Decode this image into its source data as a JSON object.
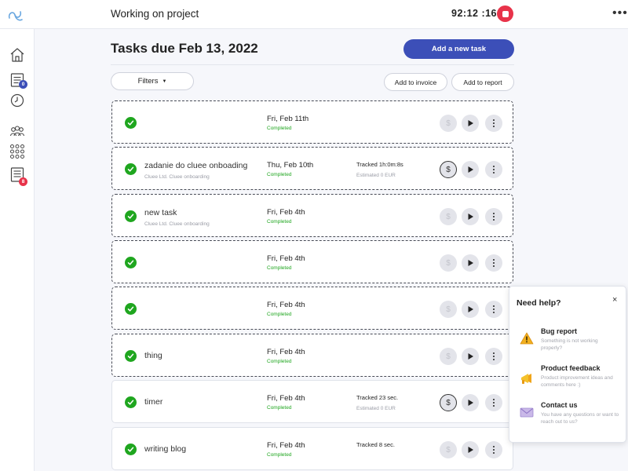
{
  "topbar": {
    "title": "Working on project",
    "timer": "92:12 :16",
    "more": "•••"
  },
  "sidebar": {
    "items": [
      {
        "name": "home",
        "icon": "home-icon"
      },
      {
        "name": "tasks",
        "icon": "tasks-list-icon",
        "badge": "0"
      },
      {
        "name": "time",
        "icon": "clock-icon"
      },
      {
        "name": "team",
        "icon": "people-icon"
      },
      {
        "name": "apps",
        "icon": "grid-icon"
      },
      {
        "name": "reports",
        "icon": "report-icon",
        "badge": "8"
      }
    ]
  },
  "main": {
    "title": "Tasks due Feb 13, 2022",
    "add_task_label": "Add a new task",
    "filters_label": "Filters",
    "add_invoice_label": "Add to invoice",
    "add_report_label": "Add to report"
  },
  "tasks": [
    {
      "name": "",
      "sub": "",
      "date": "Fri, Feb 11th",
      "status": "Completed",
      "tracked": "",
      "estimated": ""
    },
    {
      "name": "zadanie do cluee onboading",
      "sub": "Cluee Ltd. Cluee onboarding",
      "date": "Thu, Feb 10th",
      "status": "Completed",
      "tracked": "Tracked 1h:0m:8s",
      "estimated": "Estimated 0 EUR"
    },
    {
      "name": "new task",
      "sub": "Cluee Ltd. Cluee onboarding",
      "date": "Fri, Feb 4th",
      "status": "Completed",
      "tracked": "",
      "estimated": ""
    },
    {
      "name": "",
      "sub": "",
      "date": "Fri, Feb 4th",
      "status": "Completed",
      "tracked": "",
      "estimated": ""
    },
    {
      "name": "",
      "sub": "",
      "date": "Fri, Feb 4th",
      "status": "Completed",
      "tracked": "",
      "estimated": ""
    },
    {
      "name": "thing",
      "sub": "",
      "date": "Fri, Feb 4th",
      "status": "Completed",
      "tracked": "",
      "estimated": ""
    },
    {
      "name": "timer",
      "sub": "",
      "date": "Fri, Feb 4th",
      "status": "Completed",
      "tracked": "Tracked 23 sec.",
      "estimated": "Estimated 0 EUR"
    },
    {
      "name": "writing blog",
      "sub": "",
      "date": "Fri, Feb 4th",
      "status": "Completed",
      "tracked": "Tracked 8 sec.",
      "estimated": ""
    }
  ],
  "task_buttons": {
    "dollar": "$"
  },
  "help": {
    "title": "Need help?",
    "close": "×",
    "items": [
      {
        "title": "Bug report",
        "desc": "Something is not working properly?",
        "icon": "warning-icon"
      },
      {
        "title": "Product feedback",
        "desc": "Product improvement ideas and comments here :)",
        "icon": "megaphone-icon"
      },
      {
        "title": "Contact us",
        "desc": "You have any questions or want to reach out to us?",
        "icon": "envelope-icon"
      }
    ]
  },
  "colors": {
    "accent": "#3c4fb8",
    "stop": "#e8334a",
    "success": "#1fa61f"
  }
}
